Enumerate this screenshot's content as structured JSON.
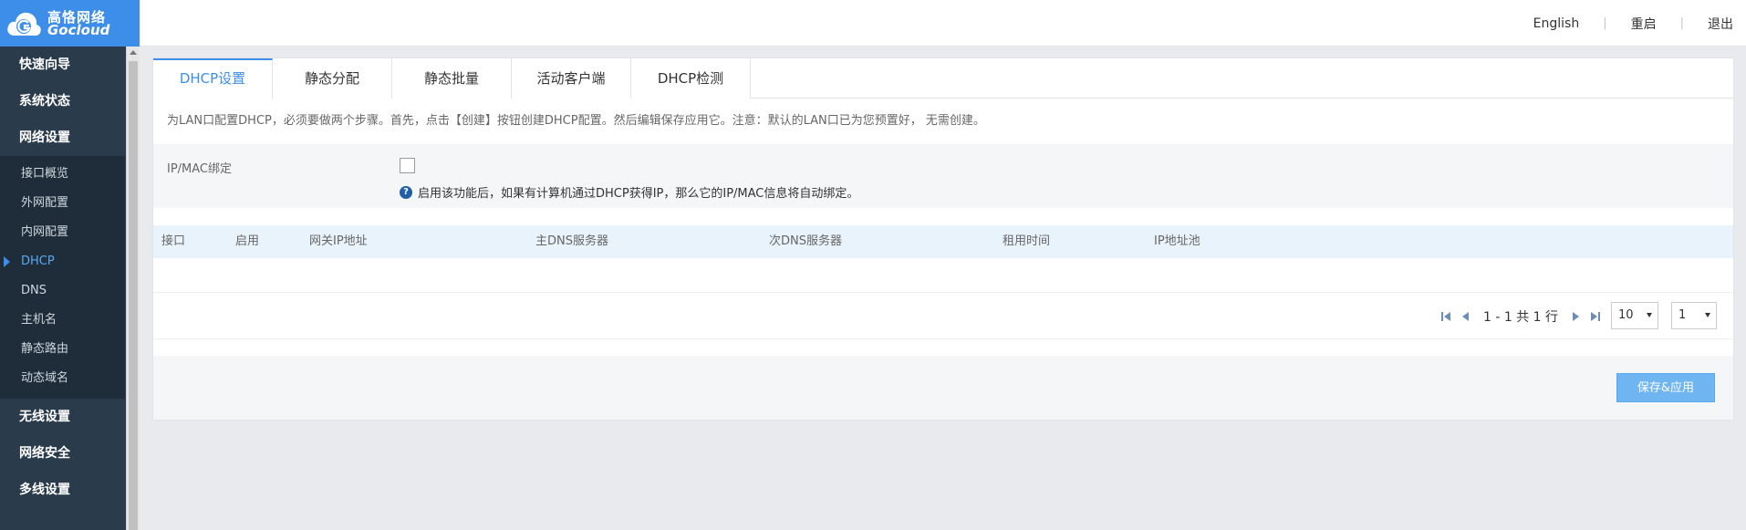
{
  "header": {
    "brand_cn": "高恪网络",
    "brand_en": "Gocloud",
    "nav": {
      "language": "English",
      "reboot": "重启",
      "logout": "退出"
    }
  },
  "sidebar": {
    "top_items": [
      "快速向导",
      "系统状态",
      "网络设置"
    ],
    "sub_items": [
      "接口概览",
      "外网配置",
      "内网配置",
      "DHCP",
      "DNS",
      "主机名",
      "静态路由",
      "动态域名"
    ],
    "active_sub": "DHCP",
    "bottom_items": [
      "无线设置",
      "网络安全",
      "多线设置"
    ]
  },
  "tabs": [
    "DHCP设置",
    "静态分配",
    "静态批量",
    "活动客户端",
    "DHCP检测"
  ],
  "active_tab": "DHCP设置",
  "description": "为LAN口配置DHCP，必须要做两个步骤。首先，点击【创建】按钮创建DHCP配置。然后编辑保存应用它。注意：默认的LAN口已为您预置好， 无需创建。",
  "ipmac": {
    "label": "IP/MAC绑定",
    "checked": false,
    "hint": "启用该功能后，如果有计算机通过DHCP获得IP，那么它的IP/MAC信息将自动绑定。"
  },
  "table": {
    "columns": [
      "接口",
      "启用",
      "网关IP地址",
      "主DNS服务器",
      "次DNS服务器",
      "租用时间",
      "IP地址池"
    ],
    "rows": []
  },
  "pager": {
    "summary": "1 - 1 共 1 行",
    "page_size": "10",
    "page": "1"
  },
  "footer": {
    "save_label": "保存&应用"
  },
  "colors": {
    "accent": "#3d8ee8",
    "sidebar_bg": "#2a3b4c",
    "save_button": "#6eb5f2"
  }
}
